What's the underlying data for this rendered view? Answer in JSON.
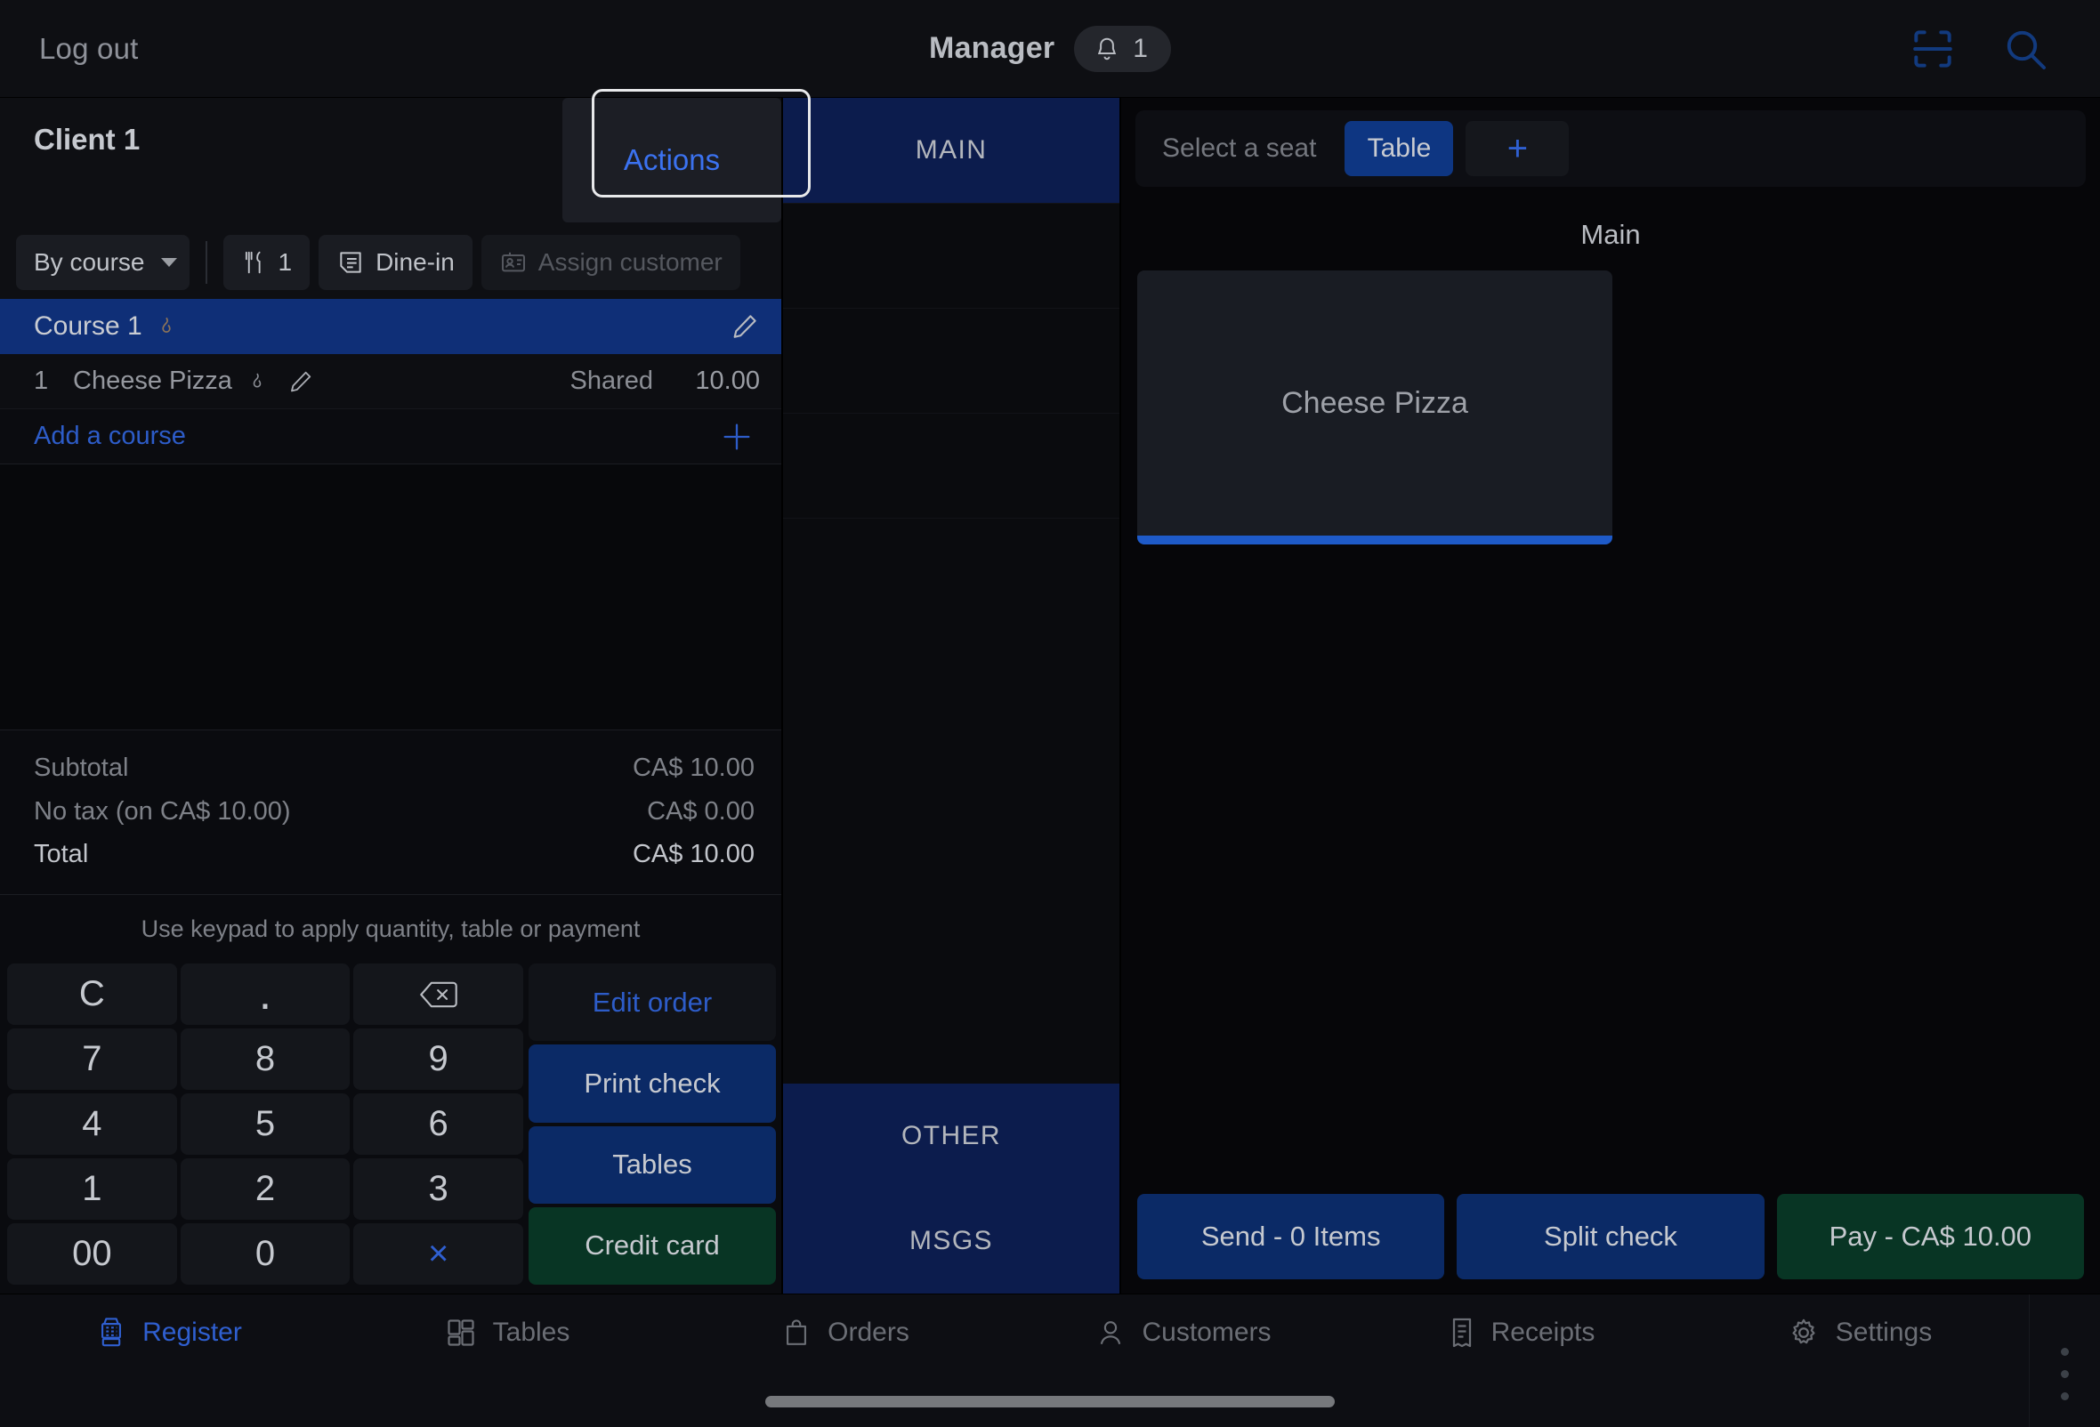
{
  "topbar": {
    "logout_label": "Log out",
    "role": "Manager",
    "notification_count": "1",
    "notification_icon": "bell-icon",
    "scan_icon": "barcode-scan-icon",
    "search_icon": "search-icon"
  },
  "order_panel": {
    "client_name": "Client 1",
    "actions_label": "Actions",
    "toolbar": {
      "sort_label": "By course",
      "guests_icon": "fork-knife-icon",
      "guests_count": "1",
      "dining_icon": "receipt-note-icon",
      "dining_label": "Dine-in",
      "customer_icon": "customer-card-icon",
      "customer_label": "Assign customer"
    },
    "course": {
      "label": "Course 1",
      "flame_icon": "flame-icon",
      "edit_icon": "pencil-icon"
    },
    "items": [
      {
        "qty": "1",
        "name": "Cheese Pizza",
        "flame_icon": "flame-icon",
        "edit_icon": "pencil-icon",
        "seat": "Shared",
        "price": "10.00"
      }
    ],
    "add_course_label": "Add a course",
    "add_course_icon": "plus-icon",
    "totals": [
      {
        "label": "Subtotal",
        "value": "CA$ 10.00"
      },
      {
        "label": "No tax (on CA$ 10.00)",
        "value": "CA$ 0.00"
      },
      {
        "label": "Total",
        "value": "CA$ 10.00"
      }
    ]
  },
  "keypad": {
    "hint": "Use keypad to apply quantity, table or payment",
    "keys": [
      "C",
      ".",
      "backspace",
      "7",
      "8",
      "9",
      "4",
      "5",
      "6",
      "1",
      "2",
      "3",
      "00",
      "0",
      "×"
    ],
    "backspace_icon": "backspace-icon",
    "side": {
      "edit_order": "Edit order",
      "print_check": "Print check",
      "tables": "Tables",
      "credit_card": "Credit card"
    }
  },
  "categories": [
    {
      "label": "MAIN",
      "state": "selected"
    },
    {
      "label": "",
      "state": "empty"
    },
    {
      "label": "",
      "state": "empty"
    },
    {
      "label": "",
      "state": "empty"
    },
    {
      "label": "",
      "state": "empty"
    },
    {
      "label": "OTHER",
      "state": "normal"
    },
    {
      "label": "MSGS",
      "state": "normal"
    }
  ],
  "right_panel": {
    "seat_label": "Select a seat",
    "seat_tab": "Table",
    "seat_add_icon": "plus-icon",
    "section_title": "Main",
    "products": [
      {
        "name": "Cheese Pizza"
      }
    ],
    "actions": [
      {
        "label": "Send - 0 Items",
        "style": "blue"
      },
      {
        "label": "Split check",
        "style": "blue"
      },
      {
        "label": "Pay - CA$ 10.00",
        "style": "green"
      }
    ]
  },
  "bottom_nav": [
    {
      "label": "Register",
      "icon": "register-icon",
      "active": true
    },
    {
      "label": "Tables",
      "icon": "tables-grid-icon",
      "active": false
    },
    {
      "label": "Orders",
      "icon": "shopping-bag-icon",
      "active": false
    },
    {
      "label": "Customers",
      "icon": "person-icon",
      "active": false
    },
    {
      "label": "Receipts",
      "icon": "receipt-icon",
      "active": false
    },
    {
      "label": "Settings",
      "icon": "gear-icon",
      "active": false
    }
  ],
  "overflow_menu_icon": "vertical-dots-icon",
  "colors": {
    "accent_blue": "#2f5fd0",
    "button_blue": "#0b2a66",
    "button_green": "#083524",
    "selected_row": "#0f2f77",
    "background": "#060609"
  }
}
